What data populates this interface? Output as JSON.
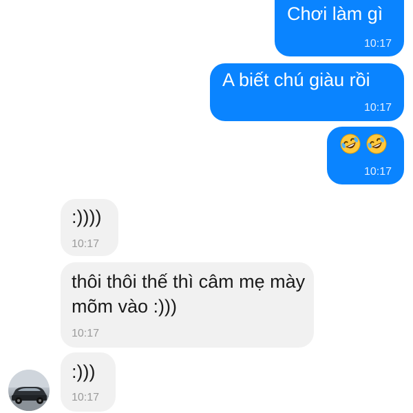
{
  "messages": [
    {
      "direction": "out",
      "text": "Chơi làm gì",
      "time": "10:17"
    },
    {
      "direction": "out",
      "text": "A biết chú giàu rồi",
      "time": "10:17"
    },
    {
      "direction": "out",
      "emojis": [
        "rolling-on-the-floor-laughing-icon",
        "rolling-on-the-floor-laughing-icon"
      ],
      "time": "10:17"
    },
    {
      "direction": "in",
      "text": ":))))",
      "time": "10:17"
    },
    {
      "direction": "in",
      "text": "thôi thôi thế thì câm mẹ mày mõm vào :)))",
      "time": "10:17"
    },
    {
      "direction": "in",
      "text": ":)))",
      "time": "10:17"
    }
  ],
  "colors": {
    "outgoing_bubble": "#0a84ff",
    "incoming_bubble": "#f1f1f1",
    "outgoing_text": "#ffffff",
    "incoming_text": "#1a1a1a"
  }
}
